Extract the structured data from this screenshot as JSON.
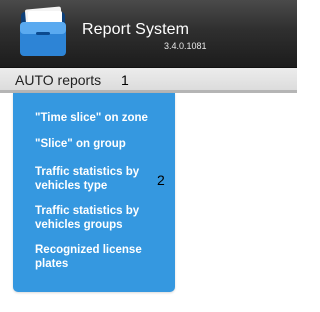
{
  "app": {
    "title": "Report System",
    "version": "3.4.0.1081",
    "logo_icon": "folder-report-icon"
  },
  "menubar": {
    "auto_reports_label": "AUTO reports"
  },
  "callouts": {
    "one": "1",
    "two": "2"
  },
  "dropdown": {
    "items": [
      {
        "label": "\"Time slice\" on zone"
      },
      {
        "label": "\"Slice\" on group"
      },
      {
        "label": "Traffic statistics by vehicles type"
      },
      {
        "label": "Traffic statistics by vehicles groups"
      },
      {
        "label": "Recognized license plates"
      }
    ]
  },
  "colors": {
    "titlebar": "#2f2f2f",
    "menubar": "#e4e4e4",
    "dropdown": "#3598e0",
    "dropdown_text": "#ffffff"
  }
}
